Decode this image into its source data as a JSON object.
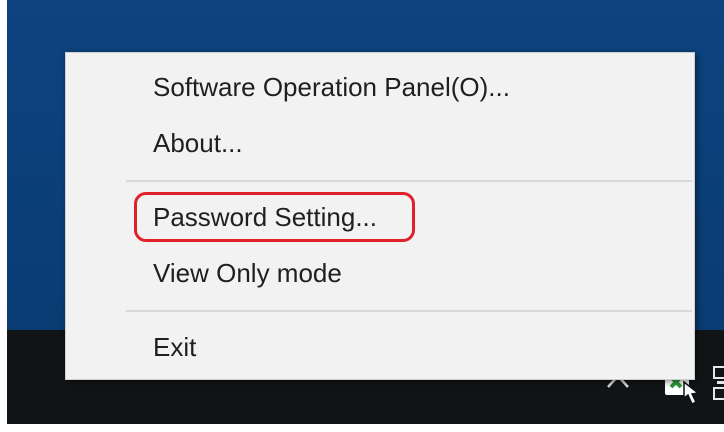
{
  "context_menu": {
    "items": [
      {
        "label": "Software Operation Panel(O)..."
      },
      {
        "label": "About..."
      },
      {
        "label": "Password Setting..."
      },
      {
        "label": "View Only mode"
      },
      {
        "label": "Exit"
      }
    ],
    "highlighted_item": "Password Setting...",
    "highlight_color": "#e0202a"
  },
  "taskbar": {
    "tray_icons": [
      "chevron-up-icon",
      "scanner-app-icon",
      "network-icon"
    ]
  },
  "colors": {
    "desktop": "#0b3f78",
    "taskbar": "#111416",
    "menu_background": "#f2f2f2"
  }
}
